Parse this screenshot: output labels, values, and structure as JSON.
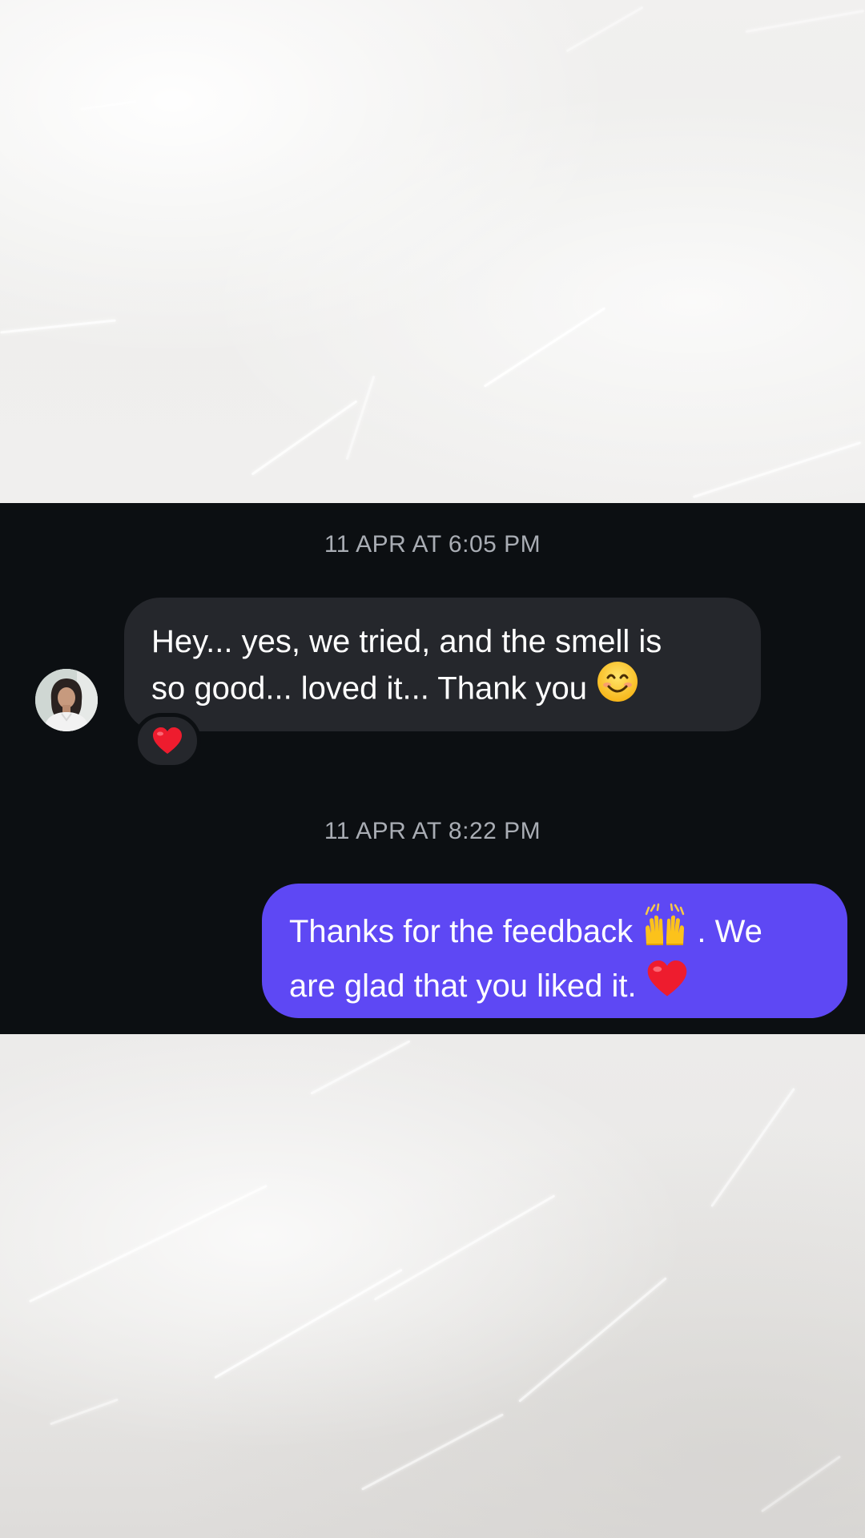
{
  "conversation": [
    {
      "timestamp": "11 APR AT 6:05 PM",
      "direction": "incoming",
      "sender_avatar": "avatar",
      "text_line1": "Hey... yes, we tried, and the smell is",
      "text_line2": "so good... loved it... Thank you",
      "trailing_emoji": "smiling-face-emoji",
      "reaction": "red-heart-emoji"
    },
    {
      "timestamp": "11 APR AT 8:22 PM",
      "direction": "outgoing",
      "text_line1_part1": "Thanks for the feedback",
      "inline_emoji": "raising-hands-emoji",
      "text_line1_part2": ". We",
      "text_line2": "are glad that you liked it.",
      "trailing_emoji": "red-heart-emoji"
    }
  ],
  "colors": {
    "chat_background": "#0c0f12",
    "incoming_bubble": "#25272c",
    "outgoing_bubble": "#5e48f4",
    "timestamp_text": "#a9adb4",
    "message_text": "#ffffff"
  }
}
